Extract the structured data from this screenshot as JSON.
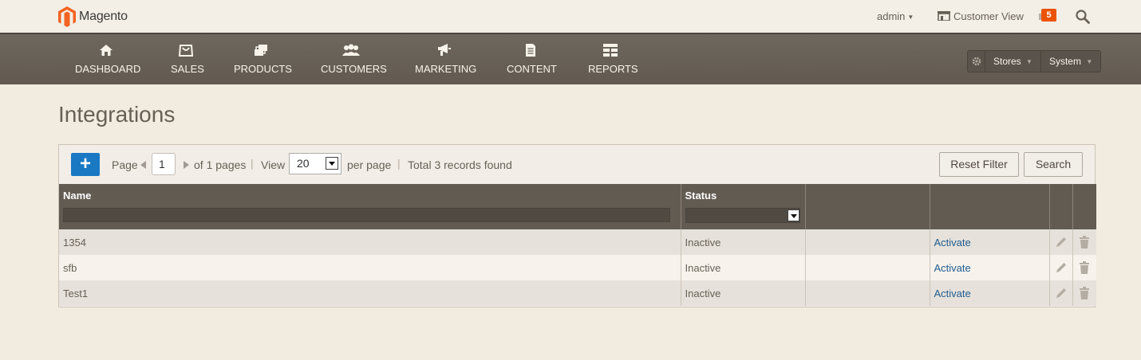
{
  "header": {
    "logo_text": "Magento",
    "admin_user": "admin",
    "customer_view": "Customer View",
    "notification_count": "5"
  },
  "nav": {
    "items": [
      {
        "label": "DASHBOARD",
        "icon": "home-icon"
      },
      {
        "label": "SALES",
        "icon": "sales-icon"
      },
      {
        "label": "PRODUCTS",
        "icon": "products-icon"
      },
      {
        "label": "CUSTOMERS",
        "icon": "customers-icon"
      },
      {
        "label": "MARKETING",
        "icon": "marketing-icon"
      },
      {
        "label": "CONTENT",
        "icon": "content-icon"
      },
      {
        "label": "REPORTS",
        "icon": "reports-icon"
      }
    ],
    "system_menu": {
      "stores": "Stores",
      "system": "System"
    }
  },
  "page": {
    "title": "Integrations"
  },
  "toolbar": {
    "add_label": "+",
    "page_label": "Page",
    "page_value": "1",
    "of_pages": "of 1 pages",
    "sep": "|",
    "view_label": "View",
    "view_value": "20",
    "per_page": "per page",
    "total": "Total 3 records found",
    "reset_filter": "Reset Filter",
    "search": "Search"
  },
  "table": {
    "headers": {
      "name": "Name",
      "status": "Status"
    },
    "rows": [
      {
        "name": "1354",
        "status": "Inactive",
        "action": "Activate"
      },
      {
        "name": "sfb",
        "status": "Inactive",
        "action": "Activate"
      },
      {
        "name": "Test1",
        "status": "Inactive",
        "action": "Activate"
      }
    ]
  },
  "colors": {
    "accent": "#1979c3",
    "nav_bg": "#625b52",
    "badge": "#eb5202",
    "link": "#1f5c91"
  }
}
